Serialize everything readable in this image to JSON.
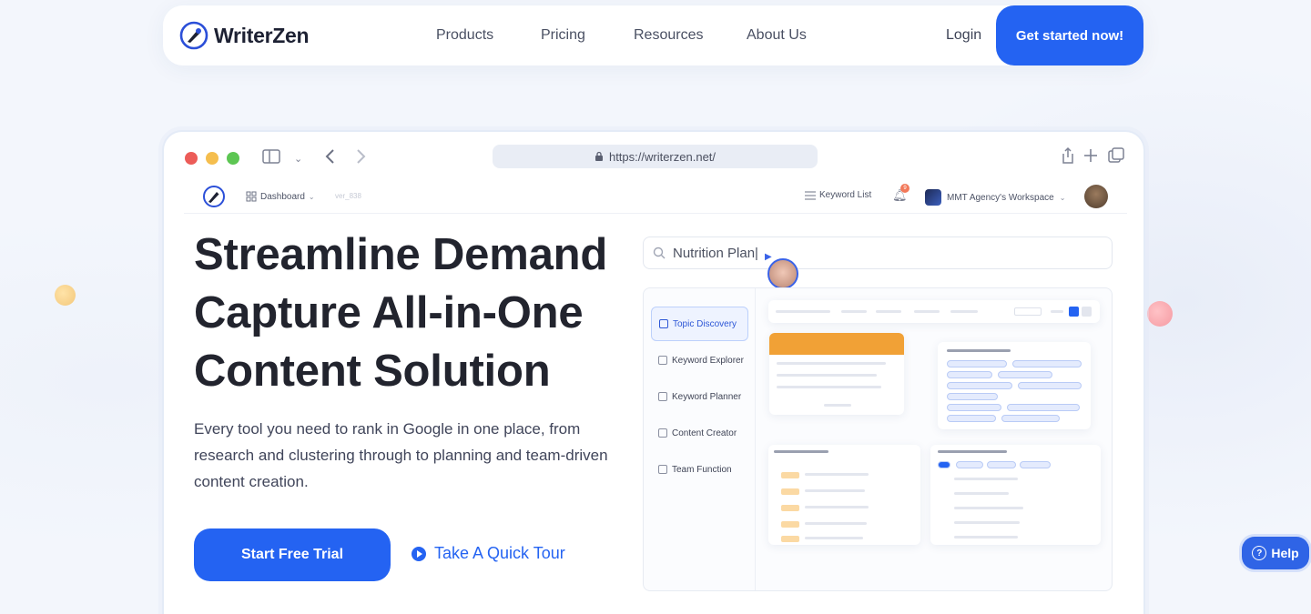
{
  "brand": {
    "name": "WriterZen"
  },
  "nav": {
    "links": [
      "Products",
      "Pricing",
      "Resources",
      "About Us"
    ],
    "login": "Login",
    "cta": "Get started now!"
  },
  "browser": {
    "url": "https://writerzen.net/"
  },
  "app": {
    "dashboard": "Dashboard",
    "faint_label": "ver_838",
    "keyword_list": "Keyword List",
    "notif_count": "9",
    "workspace": "MMT Agency's Workspace",
    "search_value": "Nutrition Plan|",
    "side_menu": [
      "Topic Discovery",
      "Keyword Explorer",
      "Keyword Planner",
      "Content Creator",
      "Team Function"
    ],
    "active_index": 0
  },
  "hero": {
    "title": "Streamline Demand Capture All-in-One Content Solution",
    "subtitle": "Every tool you need to rank in Google in one place, from research and clustering through to planning and team-driven content creation.",
    "primary_button": "Start Free Trial",
    "secondary_button": "Take A Quick Tour"
  },
  "help": {
    "label": "Help"
  },
  "colors": {
    "accent": "#2463f2",
    "orange": "#f1a136"
  },
  "icons": [
    "logo-icon",
    "sidebar-toggle-icon",
    "chevron-down-icon",
    "back-arrow-icon",
    "forward-arrow-icon",
    "lock-icon",
    "share-icon",
    "plus-icon",
    "tabs-icon",
    "grid-icon",
    "list-icon",
    "bell-icon",
    "search-icon",
    "play-icon",
    "question-icon"
  ]
}
